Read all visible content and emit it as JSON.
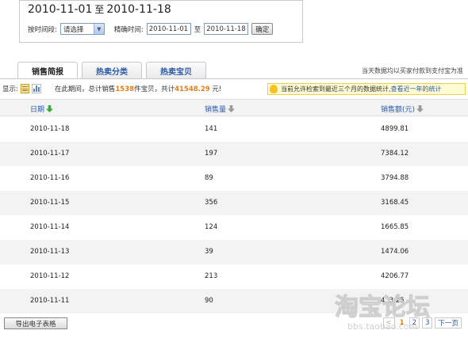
{
  "range": {
    "start": "2010-11-01",
    "sep": "至",
    "end": "2010-11-18",
    "period_label": "按时间段:",
    "period_select": "请选择",
    "exact_label": "精确时间:",
    "exact_start": "2010-11-01",
    "exact_sep": "至",
    "exact_end": "2010-11-18",
    "confirm": "确定"
  },
  "tabs": [
    {
      "label": "销售简报"
    },
    {
      "label": "热卖分类"
    },
    {
      "label": "热卖宝贝"
    }
  ],
  "note_right": "当天数据均以买家付款到支付宝为准",
  "display": {
    "label": "显示:",
    "summary_prefix": "在此期间，总计销售",
    "count": "1538",
    "summary_mid": "件宝贝，共计",
    "total": "41548.29",
    "summary_suffix": "元!"
  },
  "tip": {
    "text": "当前允许检索到最近三个月的数据统计,",
    "link": "查看近一年的统计"
  },
  "table": {
    "headers": [
      "日期",
      "销售量",
      "销售额(元)"
    ],
    "rows": [
      [
        "2010-11-18",
        "141",
        "4899.81"
      ],
      [
        "2010-11-17",
        "197",
        "7384.12"
      ],
      [
        "2010-11-16",
        "89",
        "3794.88"
      ],
      [
        "2010-11-15",
        "356",
        "3168.45"
      ],
      [
        "2010-11-14",
        "124",
        "1665.85"
      ],
      [
        "2010-11-13",
        "39",
        "1474.06"
      ],
      [
        "2010-11-12",
        "213",
        "4206.77"
      ],
      [
        "2010-11-11",
        "90",
        "4..3.25"
      ]
    ]
  },
  "export": "导出电子表格",
  "pager": {
    "prev": "<",
    "pages": [
      "1",
      "2",
      "3"
    ],
    "next": "下一页"
  },
  "watermark": {
    "text": "淘宝论坛",
    "url": "bbs.taobao.com"
  },
  "colors": {
    "link_blue": "#2a59a5",
    "accent_orange": "#e67e16",
    "row_alt": "#f3f3f3"
  }
}
